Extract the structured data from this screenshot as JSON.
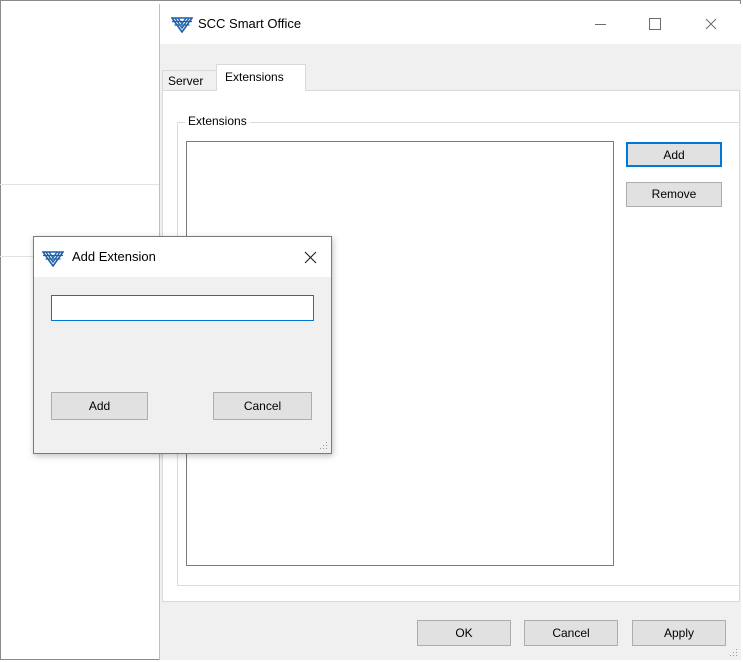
{
  "main_window": {
    "title": "SCC Smart Office",
    "tabs": [
      {
        "label": "Server",
        "selected": false
      },
      {
        "label": "Extensions",
        "selected": true
      }
    ],
    "group_label": "Extensions",
    "buttons": {
      "add": "Add",
      "remove": "Remove"
    },
    "footer": {
      "ok": "OK",
      "cancel": "Cancel",
      "apply": "Apply"
    }
  },
  "dialog": {
    "title": "Add Extension",
    "input_value": "",
    "buttons": {
      "add": "Add",
      "cancel": "Cancel"
    }
  },
  "colors": {
    "focus_accent": "#0078d7",
    "logo_blue": "#1d5fa8",
    "window_bg": "#f0f0f0"
  },
  "icons": [
    "app-logo-icon",
    "minimize-icon",
    "maximize-icon",
    "close-icon",
    "resize-grip-icon"
  ]
}
